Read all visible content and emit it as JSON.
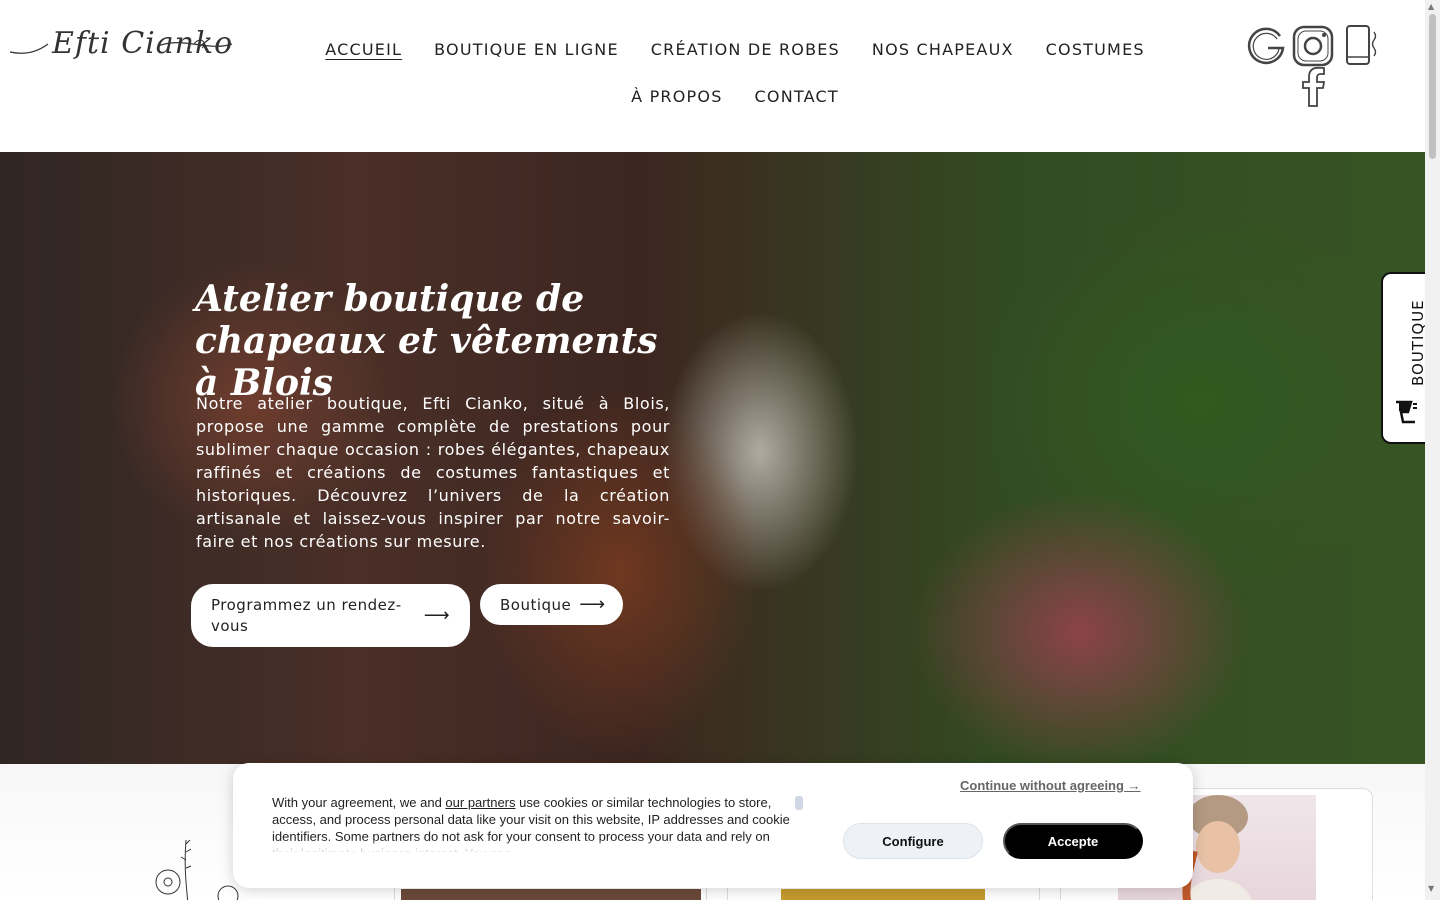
{
  "brand": {
    "logo_text": "Efti Cianko"
  },
  "nav": {
    "items": [
      {
        "label": "ACCUEIL",
        "active": true
      },
      {
        "label": "BOUTIQUE EN LIGNE"
      },
      {
        "label": "CRÉATION DE ROBES"
      },
      {
        "label": "NOS CHAPEAUX"
      },
      {
        "label": "COSTUMES"
      },
      {
        "label": "À PROPOS"
      },
      {
        "label": "CONTACT"
      }
    ]
  },
  "social": {
    "icons": [
      "google-icon",
      "instagram-icon",
      "phone-icon",
      "facebook-icon"
    ]
  },
  "hero": {
    "title": "Atelier boutique de chapeaux et vêtements à Blois",
    "text": "Notre atelier boutique, Efti Cianko, situé à Blois, propose une gamme complète de prestations pour sublimer chaque occasion : robes élégantes, chapeaux raffinés et créations de costumes fantastiques et historiques. Découvrez l’univers de la création artisanale et laissez-vous inspirer par notre savoir-faire et nos créations sur mesure.",
    "btn_rdv": "Programmez un rendez-vous",
    "btn_boutique": "Boutique",
    "arrow": "⟶"
  },
  "side_tab": {
    "label": "BOUTIQUE"
  },
  "cookie": {
    "text_before": "With your agreement, we and ",
    "partners_link": "our partners",
    "text_after": " use cookies or similar technologies to store, access, and process personal data like your visit on this website, IP addresses and cookie identifiers. Some partners do not ask for your consent to process your data and rely on their legitimate business interest. You can",
    "continue": "Continue without agreeing →",
    "configure": "Configure",
    "accept": "Accepte"
  },
  "colors": {
    "accent": "#000000",
    "hero_text": "#ffffff",
    "configure_bg": "#eef2f7"
  }
}
